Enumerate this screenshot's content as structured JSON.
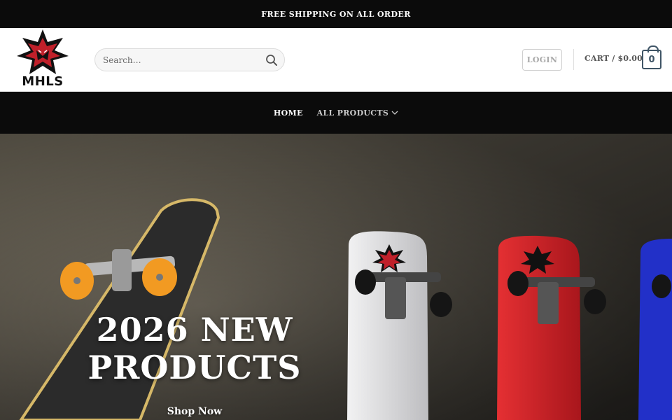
{
  "topbar": {
    "announcement": "FREE SHIPPING ON ALL ORDER"
  },
  "header": {
    "logo_text": "MHLS",
    "search": {
      "placeholder": "Search…",
      "value": ""
    },
    "login_label": "LOGIN",
    "cart_label": "CART / $0.00",
    "cart_count": "0"
  },
  "nav": {
    "items": [
      {
        "label": "HOME",
        "active": true
      },
      {
        "label": "ALL PRODUCTS",
        "active": false,
        "has_dropdown": true
      }
    ]
  },
  "hero": {
    "title_line1": "2026 NEW",
    "title_line2": "PRODUCTS",
    "button_label": "Shop Now"
  },
  "colors": {
    "bar_bg": "#0b0b0b",
    "logo_red": "#c0202a",
    "cart_outline": "#3f5566",
    "deck_white": "#e4e4e6",
    "deck_red": "#d8242b",
    "deck_blue": "#2230c8",
    "wheel_orange": "#f29a22"
  },
  "icons": {
    "search": "search-icon",
    "chevron": "chevron-down-icon",
    "logo": "star-logo-icon"
  }
}
